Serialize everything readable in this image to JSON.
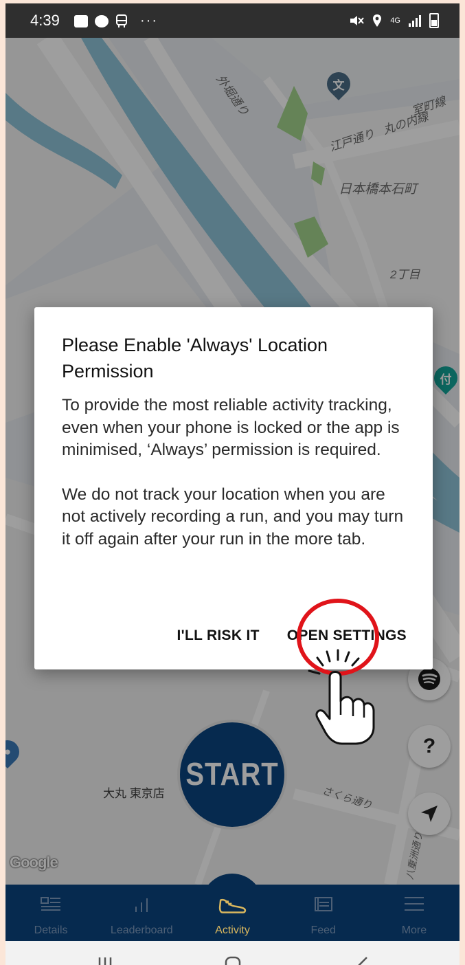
{
  "status_bar": {
    "time": "4:39",
    "left_icons": [
      "image-icon",
      "app-badge-icon",
      "bus-icon"
    ],
    "overflow": "···",
    "network": "4G"
  },
  "map": {
    "labels": {
      "sotobori": "外堀通り",
      "edo": "江戸通り",
      "marunouchi": "丸の内線",
      "muromachi": "室町線",
      "nihonbashi": "日本橋本石町",
      "chome": "2丁目",
      "daimaru": "大丸 東京店",
      "sakura": "さくら通り",
      "yaesu": "八重洲通り"
    },
    "pins": {
      "school": "文",
      "museum": "付"
    },
    "attribution": "Google"
  },
  "dialog": {
    "title": "Please Enable 'Always' Location Permission",
    "body_1": "To provide the most reliable activity tracking, even when your phone is locked or the app is minimised, ‘Always’ permission is required.",
    "body_2": "We do not track your location when you are not actively recording a run, and you may turn it off again after your run in the more tab.",
    "risk_label": "I'LL RISK IT",
    "settings_label": "OPEN SETTINGS"
  },
  "start_label": "START",
  "help_label": "?",
  "tabs": [
    {
      "label": "Details",
      "icon": "details-icon"
    },
    {
      "label": "Leaderboard",
      "icon": "leaderboard-icon"
    },
    {
      "label": "Activity",
      "icon": "shoe-icon"
    },
    {
      "label": "Feed",
      "icon": "feed-icon"
    },
    {
      "label": "More",
      "icon": "menu-icon"
    }
  ],
  "colors": {
    "brand_blue": "#0b4580",
    "active_tab": "#d9b75e",
    "highlight_ring": "#e0141a"
  }
}
